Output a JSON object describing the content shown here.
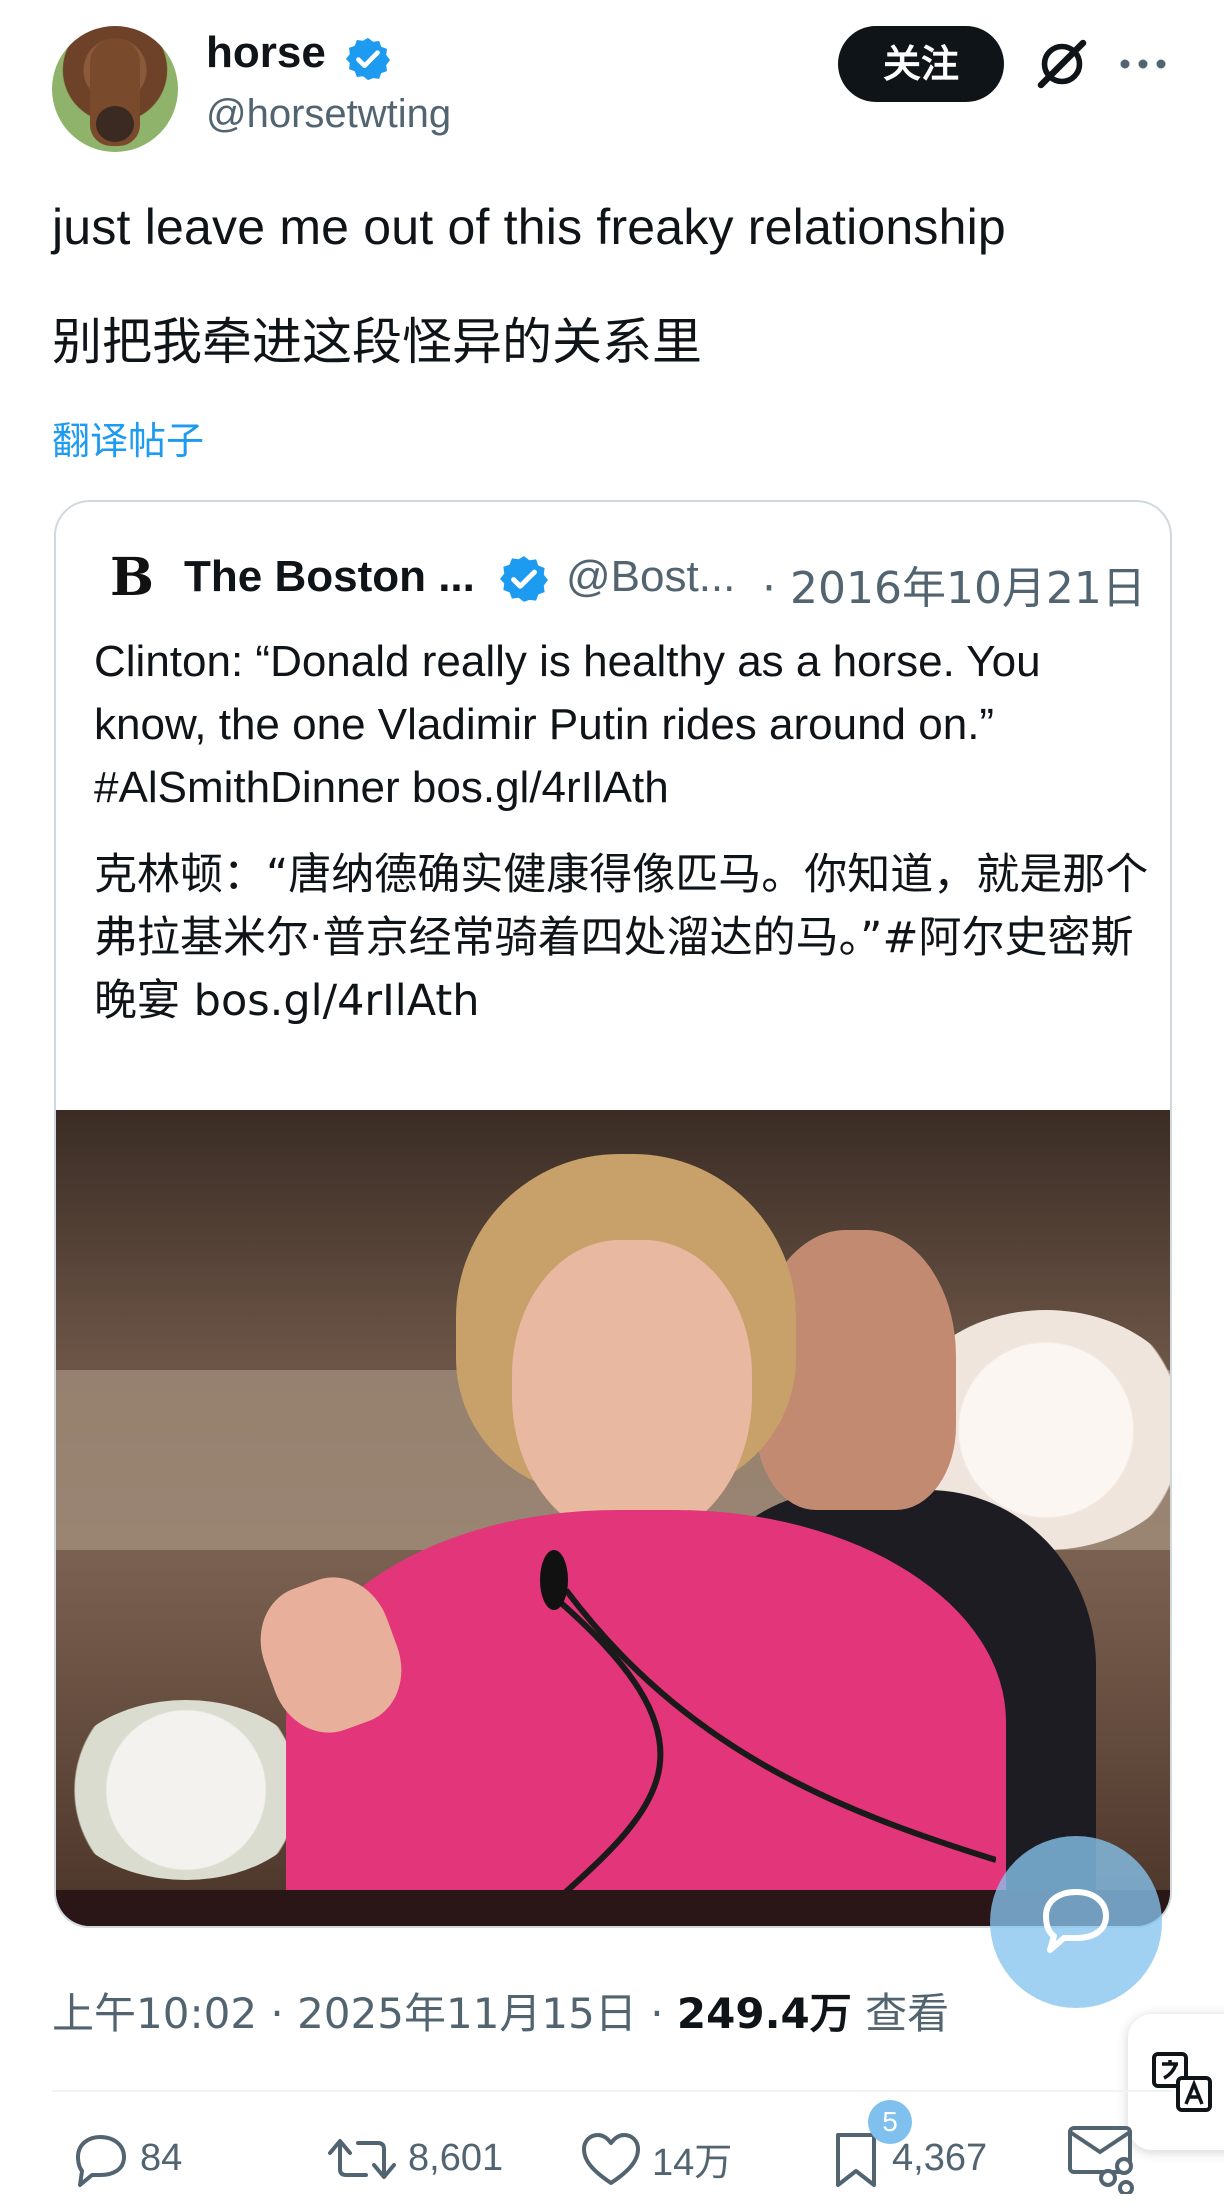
{
  "author": {
    "name": "horse",
    "handle": "@horsetwting",
    "follow_label": "关注"
  },
  "post": {
    "text": "just leave me out of this freaky relationship",
    "text_translated": "别把我牵进这段怪异的关系里",
    "translate_label": "翻译帖子"
  },
  "quote": {
    "logo": "B",
    "name": "The Boston ...",
    "handle": "@Bost...",
    "date": "· 2016年10月21日",
    "text": "Clinton: “Donald really is healthy as a horse. You know, the one Vladimir Putin rides around on.” #AlSmithDinner bos.gl/4rIlAth",
    "text_translated": "克林顿：“唐纳德确实健康得像匹马。你知道，就是那个弗拉基米尔·普京经常骑着四处溜达的马。”#阿尔史密斯晚宴 bos.gl/4rIlAth"
  },
  "meta": {
    "time": "上午10:02 · 2025年11月15日 · ",
    "views": "249.4万",
    "views_label": " 查看"
  },
  "actions": {
    "replies": "84",
    "reposts": "8,601",
    "likes": "14万",
    "bookmarks": "4,367",
    "bookmark_badge": "5"
  },
  "colors": {
    "accent": "#1d9bf0",
    "text": "#0f1419",
    "muted": "#536471",
    "border": "#cfd9de",
    "follow_bg": "#0f1419"
  },
  "icons": [
    "verified-badge-icon",
    "grok-icon",
    "more-icon",
    "reply-fab-icon",
    "translate-icon",
    "reply-icon",
    "repost-icon",
    "like-icon",
    "bookmark-icon",
    "share-icon"
  ]
}
